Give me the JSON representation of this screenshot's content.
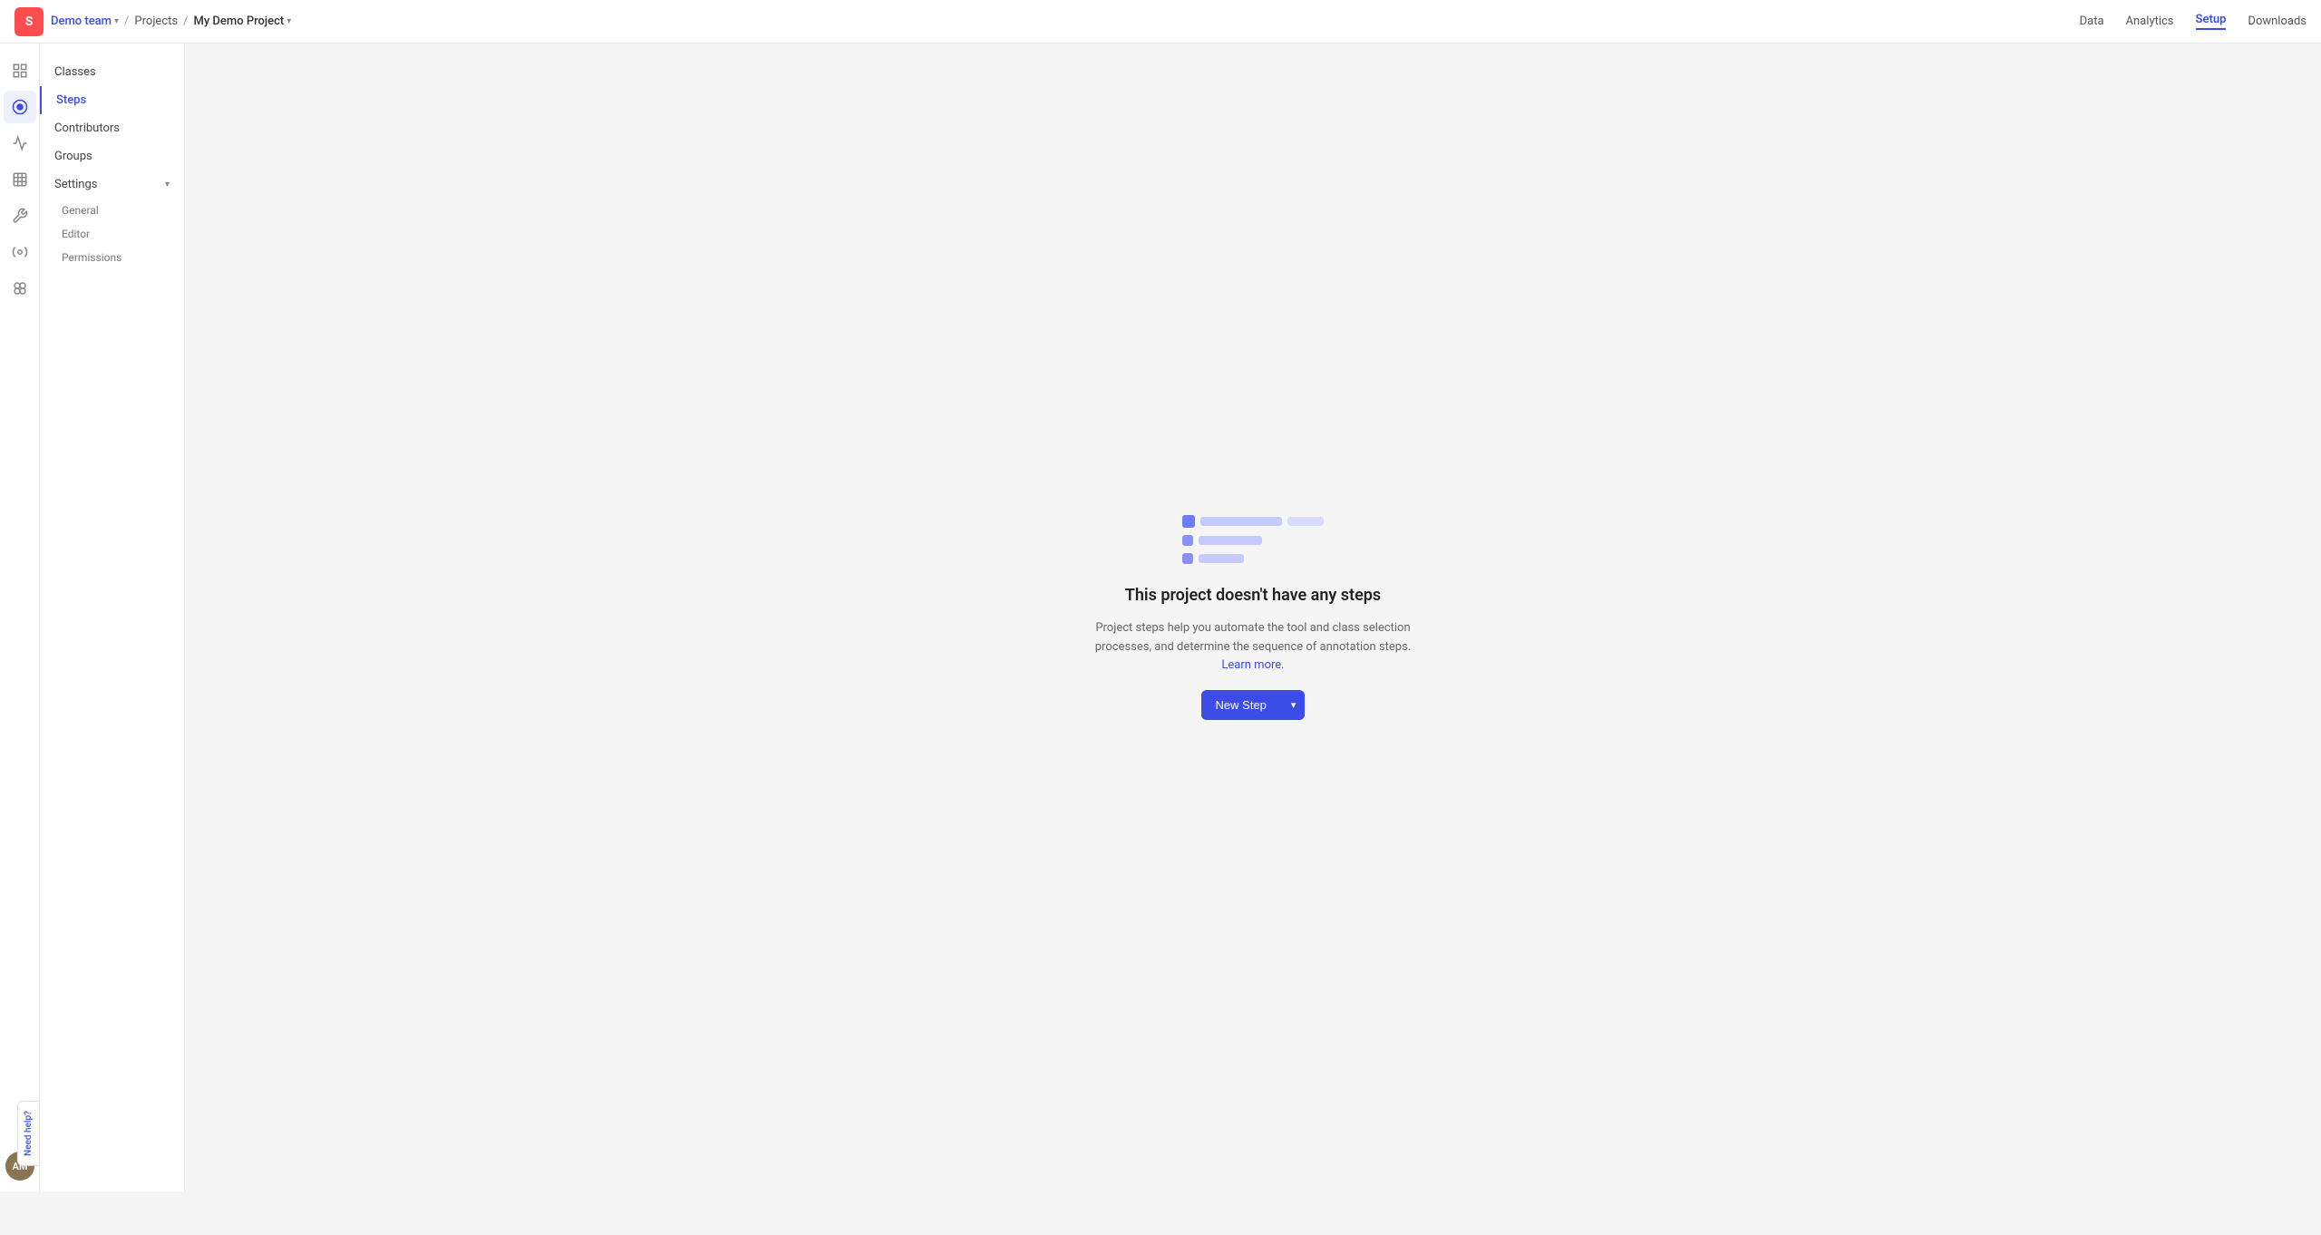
{
  "app": {
    "logo": "S",
    "logo_bg": "#e74444"
  },
  "breadcrumb": {
    "team": "Demo team",
    "projects": "Projects",
    "project": "My Demo Project"
  },
  "top_nav": {
    "links": [
      {
        "label": "Data",
        "active": false
      },
      {
        "label": "Analytics",
        "active": false
      },
      {
        "label": "Setup",
        "active": true
      },
      {
        "label": "Downloads",
        "active": false
      }
    ]
  },
  "icon_sidebar": {
    "items": [
      {
        "icon": "📊",
        "name": "dashboard-icon"
      },
      {
        "icon": "🏷️",
        "name": "label-icon"
      },
      {
        "icon": "📈",
        "name": "analytics-icon"
      },
      {
        "icon": "⊞",
        "name": "grid-icon"
      },
      {
        "icon": "🔧",
        "name": "tools-icon"
      },
      {
        "icon": "⚙️",
        "name": "integrations-icon"
      },
      {
        "icon": "⊕",
        "name": "apps-icon"
      }
    ]
  },
  "text_sidebar": {
    "items": [
      {
        "label": "Classes",
        "active": false,
        "type": "main"
      },
      {
        "label": "Steps",
        "active": true,
        "type": "main"
      },
      {
        "label": "Contributors",
        "active": false,
        "type": "main"
      },
      {
        "label": "Groups",
        "active": false,
        "type": "main"
      },
      {
        "label": "Settings",
        "active": false,
        "type": "main",
        "expandable": true,
        "expanded": true
      },
      {
        "label": "General",
        "active": false,
        "type": "sub"
      },
      {
        "label": "Editor",
        "active": false,
        "type": "sub"
      },
      {
        "label": "Permissions",
        "active": false,
        "type": "sub"
      }
    ]
  },
  "empty_state": {
    "title": "This project doesn't have any steps",
    "description": "Project steps help you automate the tool and class selection processes, and determine the sequence of annotation steps.",
    "learn_more": "Learn more.",
    "new_step_button": "New Step"
  },
  "avatar": {
    "initials": "AM"
  },
  "need_help": {
    "label": "Need help?"
  }
}
